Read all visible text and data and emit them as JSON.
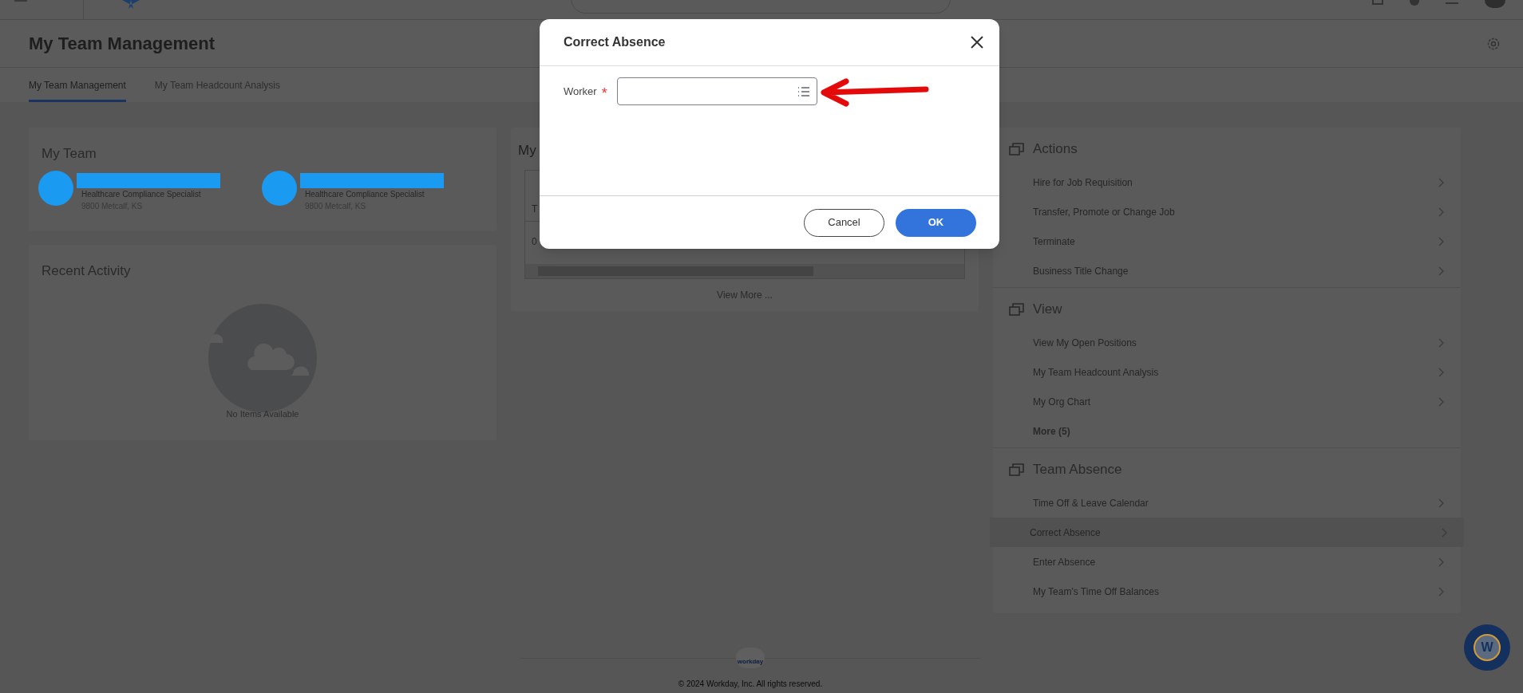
{
  "page": {
    "title": "My Team Management"
  },
  "tabs": [
    {
      "label": "My Team Management",
      "selected": true
    },
    {
      "label": "My Team Headcount Analysis",
      "selected": false
    }
  ],
  "my_team": {
    "title": "My Team",
    "members": [
      {
        "job": "Healthcare Compliance Specialist",
        "location": "9800 Metcalf, KS"
      },
      {
        "job": "Healthcare Compliance Specialist",
        "location": "9800 Metcalf, KS"
      }
    ]
  },
  "recent_activity": {
    "title": "Recent Activity",
    "empty_text": "No Items Available"
  },
  "middle_card": {
    "title": "My",
    "header_cell": "T",
    "body_cell": "0",
    "link": "View More ..."
  },
  "side_panel": {
    "sections": [
      {
        "title": "Actions",
        "items": [
          {
            "label": "Hire for Job Requisition",
            "kind": "link",
            "selected": false
          },
          {
            "label": "Transfer, Promote or Change Job",
            "kind": "link",
            "selected": false
          },
          {
            "label": "Terminate",
            "kind": "link",
            "selected": false
          },
          {
            "label": "Business Title Change",
            "kind": "link",
            "selected": false
          }
        ]
      },
      {
        "title": "View",
        "items": [
          {
            "label": "View My Open Positions",
            "kind": "link",
            "selected": false
          },
          {
            "label": "My Team Headcount Analysis",
            "kind": "link",
            "selected": false
          },
          {
            "label": "My Org Chart",
            "kind": "link",
            "selected": false
          },
          {
            "label": "More (5)",
            "kind": "more",
            "selected": false
          }
        ]
      },
      {
        "title": "Team Absence",
        "items": [
          {
            "label": "Time Off & Leave Calendar",
            "kind": "link",
            "selected": false
          },
          {
            "label": "Correct Absence",
            "kind": "link",
            "selected": true
          },
          {
            "label": "Enter Absence",
            "kind": "link",
            "selected": false
          },
          {
            "label": "My Team's Time Off Balances",
            "kind": "link",
            "selected": false
          }
        ]
      }
    ]
  },
  "dialog": {
    "title": "Correct Absence",
    "field": {
      "label": "Worker",
      "required_mark": "*"
    },
    "buttons": [
      {
        "label": "Cancel",
        "kind": "secondary"
      },
      {
        "label": "OK",
        "kind": "primary"
      }
    ]
  },
  "footer": {
    "logo_text": "workday",
    "copyright": "© 2024 Workday, Inc. All rights reserved."
  },
  "chat_button": {
    "label": "W"
  }
}
